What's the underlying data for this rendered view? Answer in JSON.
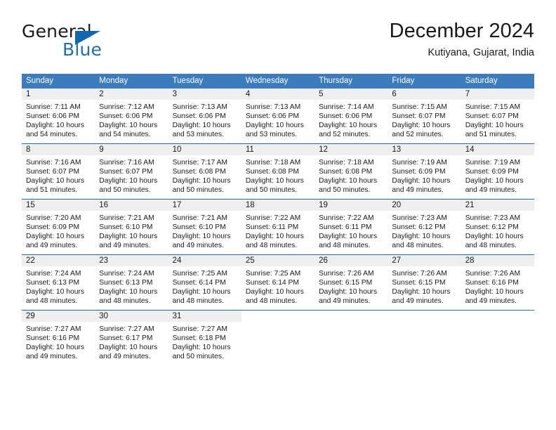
{
  "brand": {
    "name_part1": "General",
    "name_part2": "Blue",
    "logo_icon": "triangle-flag-icon"
  },
  "header": {
    "title": "December 2024",
    "subtitle": "Kutiyana, Gujarat, India"
  },
  "theme": {
    "header_bg": "#3b7cbf",
    "row_divider": "#2a68a8",
    "daynum_band": "#efefef",
    "brand_blue": "#1267b1",
    "text": "#1a1a1a"
  },
  "weekday_headers": [
    "Sunday",
    "Monday",
    "Tuesday",
    "Wednesday",
    "Thursday",
    "Friday",
    "Saturday"
  ],
  "weeks": [
    [
      {
        "day": "1",
        "sunrise": "Sunrise: 7:11 AM",
        "sunset": "Sunset: 6:06 PM",
        "daylight_line1": "Daylight: 10 hours",
        "daylight_line2": "and 54 minutes."
      },
      {
        "day": "2",
        "sunrise": "Sunrise: 7:12 AM",
        "sunset": "Sunset: 6:06 PM",
        "daylight_line1": "Daylight: 10 hours",
        "daylight_line2": "and 54 minutes."
      },
      {
        "day": "3",
        "sunrise": "Sunrise: 7:13 AM",
        "sunset": "Sunset: 6:06 PM",
        "daylight_line1": "Daylight: 10 hours",
        "daylight_line2": "and 53 minutes."
      },
      {
        "day": "4",
        "sunrise": "Sunrise: 7:13 AM",
        "sunset": "Sunset: 6:06 PM",
        "daylight_line1": "Daylight: 10 hours",
        "daylight_line2": "and 53 minutes."
      },
      {
        "day": "5",
        "sunrise": "Sunrise: 7:14 AM",
        "sunset": "Sunset: 6:06 PM",
        "daylight_line1": "Daylight: 10 hours",
        "daylight_line2": "and 52 minutes."
      },
      {
        "day": "6",
        "sunrise": "Sunrise: 7:15 AM",
        "sunset": "Sunset: 6:07 PM",
        "daylight_line1": "Daylight: 10 hours",
        "daylight_line2": "and 52 minutes."
      },
      {
        "day": "7",
        "sunrise": "Sunrise: 7:15 AM",
        "sunset": "Sunset: 6:07 PM",
        "daylight_line1": "Daylight: 10 hours",
        "daylight_line2": "and 51 minutes."
      }
    ],
    [
      {
        "day": "8",
        "sunrise": "Sunrise: 7:16 AM",
        "sunset": "Sunset: 6:07 PM",
        "daylight_line1": "Daylight: 10 hours",
        "daylight_line2": "and 51 minutes."
      },
      {
        "day": "9",
        "sunrise": "Sunrise: 7:16 AM",
        "sunset": "Sunset: 6:07 PM",
        "daylight_line1": "Daylight: 10 hours",
        "daylight_line2": "and 50 minutes."
      },
      {
        "day": "10",
        "sunrise": "Sunrise: 7:17 AM",
        "sunset": "Sunset: 6:08 PM",
        "daylight_line1": "Daylight: 10 hours",
        "daylight_line2": "and 50 minutes."
      },
      {
        "day": "11",
        "sunrise": "Sunrise: 7:18 AM",
        "sunset": "Sunset: 6:08 PM",
        "daylight_line1": "Daylight: 10 hours",
        "daylight_line2": "and 50 minutes."
      },
      {
        "day": "12",
        "sunrise": "Sunrise: 7:18 AM",
        "sunset": "Sunset: 6:08 PM",
        "daylight_line1": "Daylight: 10 hours",
        "daylight_line2": "and 50 minutes."
      },
      {
        "day": "13",
        "sunrise": "Sunrise: 7:19 AM",
        "sunset": "Sunset: 6:09 PM",
        "daylight_line1": "Daylight: 10 hours",
        "daylight_line2": "and 49 minutes."
      },
      {
        "day": "14",
        "sunrise": "Sunrise: 7:19 AM",
        "sunset": "Sunset: 6:09 PM",
        "daylight_line1": "Daylight: 10 hours",
        "daylight_line2": "and 49 minutes."
      }
    ],
    [
      {
        "day": "15",
        "sunrise": "Sunrise: 7:20 AM",
        "sunset": "Sunset: 6:09 PM",
        "daylight_line1": "Daylight: 10 hours",
        "daylight_line2": "and 49 minutes."
      },
      {
        "day": "16",
        "sunrise": "Sunrise: 7:21 AM",
        "sunset": "Sunset: 6:10 PM",
        "daylight_line1": "Daylight: 10 hours",
        "daylight_line2": "and 49 minutes."
      },
      {
        "day": "17",
        "sunrise": "Sunrise: 7:21 AM",
        "sunset": "Sunset: 6:10 PM",
        "daylight_line1": "Daylight: 10 hours",
        "daylight_line2": "and 49 minutes."
      },
      {
        "day": "18",
        "sunrise": "Sunrise: 7:22 AM",
        "sunset": "Sunset: 6:11 PM",
        "daylight_line1": "Daylight: 10 hours",
        "daylight_line2": "and 48 minutes."
      },
      {
        "day": "19",
        "sunrise": "Sunrise: 7:22 AM",
        "sunset": "Sunset: 6:11 PM",
        "daylight_line1": "Daylight: 10 hours",
        "daylight_line2": "and 48 minutes."
      },
      {
        "day": "20",
        "sunrise": "Sunrise: 7:23 AM",
        "sunset": "Sunset: 6:12 PM",
        "daylight_line1": "Daylight: 10 hours",
        "daylight_line2": "and 48 minutes."
      },
      {
        "day": "21",
        "sunrise": "Sunrise: 7:23 AM",
        "sunset": "Sunset: 6:12 PM",
        "daylight_line1": "Daylight: 10 hours",
        "daylight_line2": "and 48 minutes."
      }
    ],
    [
      {
        "day": "22",
        "sunrise": "Sunrise: 7:24 AM",
        "sunset": "Sunset: 6:13 PM",
        "daylight_line1": "Daylight: 10 hours",
        "daylight_line2": "and 48 minutes."
      },
      {
        "day": "23",
        "sunrise": "Sunrise: 7:24 AM",
        "sunset": "Sunset: 6:13 PM",
        "daylight_line1": "Daylight: 10 hours",
        "daylight_line2": "and 48 minutes."
      },
      {
        "day": "24",
        "sunrise": "Sunrise: 7:25 AM",
        "sunset": "Sunset: 6:14 PM",
        "daylight_line1": "Daylight: 10 hours",
        "daylight_line2": "and 48 minutes."
      },
      {
        "day": "25",
        "sunrise": "Sunrise: 7:25 AM",
        "sunset": "Sunset: 6:14 PM",
        "daylight_line1": "Daylight: 10 hours",
        "daylight_line2": "and 48 minutes."
      },
      {
        "day": "26",
        "sunrise": "Sunrise: 7:26 AM",
        "sunset": "Sunset: 6:15 PM",
        "daylight_line1": "Daylight: 10 hours",
        "daylight_line2": "and 49 minutes."
      },
      {
        "day": "27",
        "sunrise": "Sunrise: 7:26 AM",
        "sunset": "Sunset: 6:15 PM",
        "daylight_line1": "Daylight: 10 hours",
        "daylight_line2": "and 49 minutes."
      },
      {
        "day": "28",
        "sunrise": "Sunrise: 7:26 AM",
        "sunset": "Sunset: 6:16 PM",
        "daylight_line1": "Daylight: 10 hours",
        "daylight_line2": "and 49 minutes."
      }
    ],
    [
      {
        "day": "29",
        "sunrise": "Sunrise: 7:27 AM",
        "sunset": "Sunset: 6:16 PM",
        "daylight_line1": "Daylight: 10 hours",
        "daylight_line2": "and 49 minutes."
      },
      {
        "day": "30",
        "sunrise": "Sunrise: 7:27 AM",
        "sunset": "Sunset: 6:17 PM",
        "daylight_line1": "Daylight: 10 hours",
        "daylight_line2": "and 49 minutes."
      },
      {
        "day": "31",
        "sunrise": "Sunrise: 7:27 AM",
        "sunset": "Sunset: 6:18 PM",
        "daylight_line1": "Daylight: 10 hours",
        "daylight_line2": "and 50 minutes."
      },
      {
        "day": "",
        "sunrise": "",
        "sunset": "",
        "daylight_line1": "",
        "daylight_line2": ""
      },
      {
        "day": "",
        "sunrise": "",
        "sunset": "",
        "daylight_line1": "",
        "daylight_line2": ""
      },
      {
        "day": "",
        "sunrise": "",
        "sunset": "",
        "daylight_line1": "",
        "daylight_line2": ""
      },
      {
        "day": "",
        "sunrise": "",
        "sunset": "",
        "daylight_line1": "",
        "daylight_line2": ""
      }
    ]
  ]
}
